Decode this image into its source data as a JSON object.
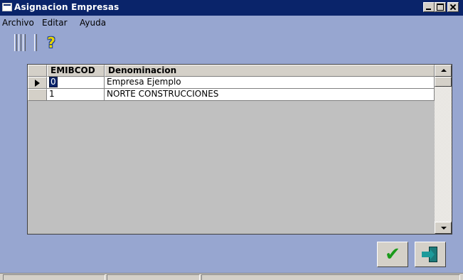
{
  "window": {
    "title": "Asignacion Empresas"
  },
  "menu": {
    "items": [
      "Archivo",
      "Editar",
      "Ayuda"
    ]
  },
  "toolbar": {
    "help_icon": "help-question-icon"
  },
  "grid": {
    "headers": [
      "EMIBCOD",
      "Denominacion"
    ],
    "rows": [
      {
        "code": "0",
        "name": "Empresa Ejemplo",
        "current": true
      },
      {
        "code": "1",
        "name": "NORTE CONSTRUCCIONES",
        "current": false
      }
    ]
  },
  "actions": {
    "ok_icon": "checkmark-icon",
    "exit_icon": "exit-door-icon"
  },
  "colors": {
    "title_bar": "#0a246a",
    "background": "#97a6d0",
    "grid_background": "#c0c0c0"
  }
}
